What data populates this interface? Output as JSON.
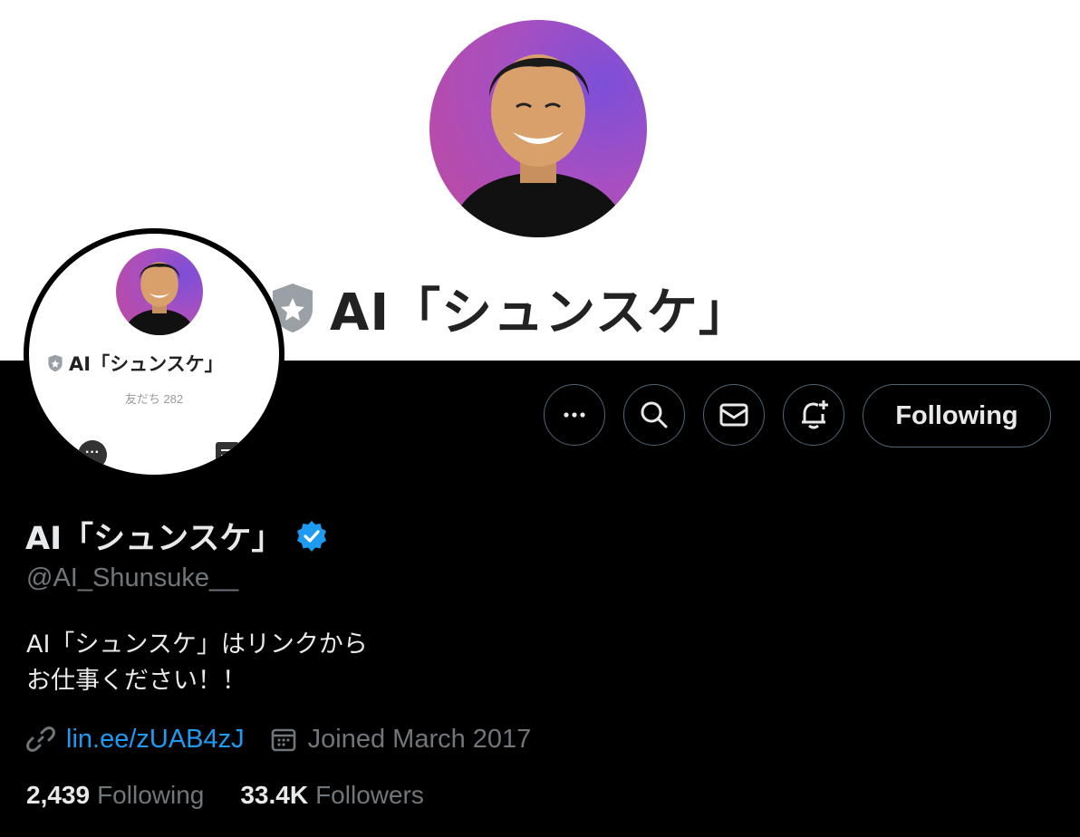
{
  "banner": {
    "name": "AI「シュンスケ」"
  },
  "avatar": {
    "name": "AI「シュンスケ」",
    "friends": "友だち 282"
  },
  "actions": {
    "follow_label": "Following"
  },
  "profile": {
    "display_name": "AI「シュンスケ」",
    "handle": "@AI_Shunsuke__",
    "bio": "AI「シュンスケ」はリンクから\nお仕事ください！！",
    "link": "lin.ee/zUAB4zJ",
    "joined": "Joined March 2017"
  },
  "stats": {
    "following_count": "2,439",
    "following_label": "Following",
    "followers_count": "33.4K",
    "followers_label": "Followers"
  },
  "colors": {
    "link": "#1d9bf0",
    "verified": "#1d9bf0",
    "secondary_text": "#71767b"
  }
}
